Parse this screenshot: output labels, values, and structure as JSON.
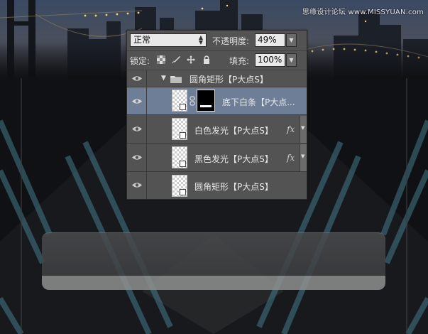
{
  "watermark": "思缘设计论坛 www.MISSYUAN.com",
  "layers_panel": {
    "blend_mode": "正常",
    "opacity_label": "不透明度:",
    "opacity_value": "49%",
    "lock_label": "锁定:",
    "fill_label": "填充:",
    "fill_value": "100%",
    "group": {
      "name": "圆角矩形【P大点S】",
      "expanded": true
    },
    "layers": [
      {
        "name": "底下白条【P大点...",
        "selected": true,
        "has_mask": true,
        "has_fx": false
      },
      {
        "name": "白色发光【P大点S】",
        "selected": false,
        "has_mask": false,
        "has_fx": true
      },
      {
        "name": "黑色发光【P大点S】",
        "selected": false,
        "has_mask": false,
        "has_fx": true
      },
      {
        "name": "圆角矩形【P大点S】",
        "selected": false,
        "has_mask": false,
        "has_fx": false
      }
    ],
    "fx_label": "fx"
  },
  "colors": {
    "panel_bg": "#535353",
    "selected_row": "#6d7e96",
    "accent_stripe": "#4f8fa3"
  }
}
